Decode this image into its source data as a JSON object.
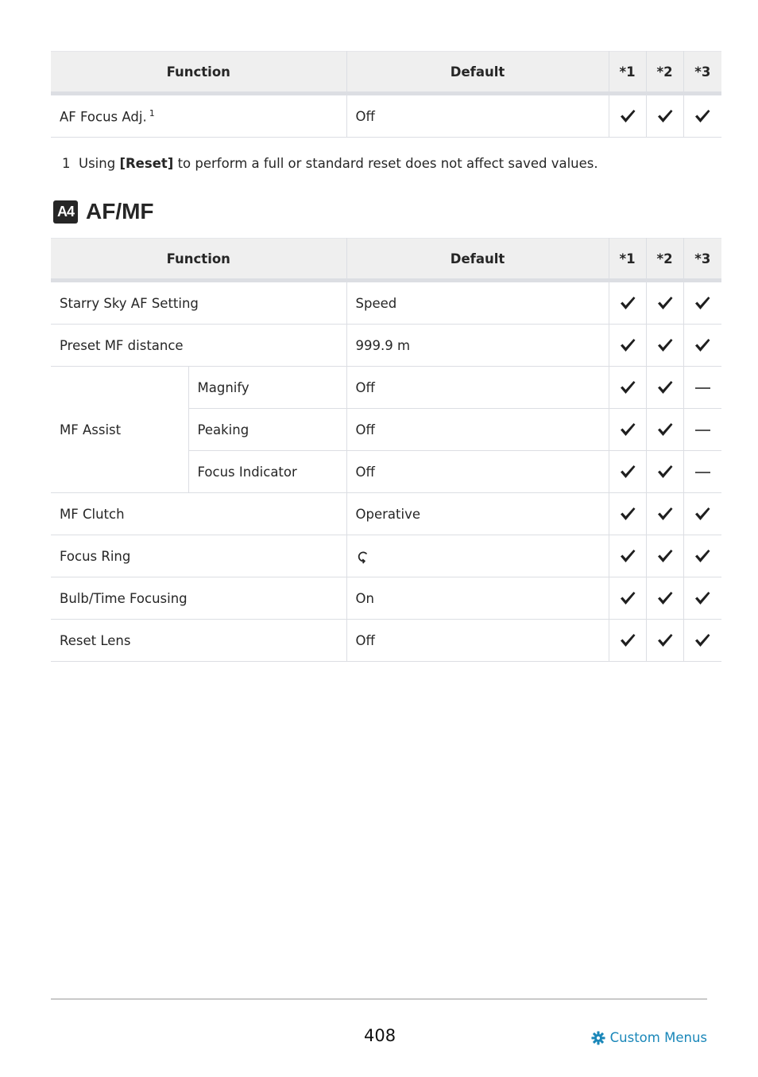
{
  "table1": {
    "headers": {
      "function": "Function",
      "default": "Default",
      "c1": "*1",
      "c2": "*2",
      "c3": "*3"
    },
    "rows": [
      {
        "function": "AF Focus Adj.",
        "footnote_ref": "1",
        "default": "Off",
        "marks": [
          "check",
          "check",
          "check"
        ]
      }
    ]
  },
  "footnote": {
    "number": "1",
    "text_before": "Using ",
    "bold": "[Reset]",
    "text_after": " to perform a full or standard reset does not affect saved values."
  },
  "section": {
    "badge": "A4",
    "title": "AF/MF"
  },
  "table2": {
    "headers": {
      "function": "Function",
      "default": "Default",
      "c1": "*1",
      "c2": "*2",
      "c3": "*3"
    },
    "rows": [
      {
        "function": "Starry Sky AF Setting",
        "default": "Speed",
        "marks": [
          "check",
          "check",
          "check"
        ]
      },
      {
        "function": "Preset MF distance",
        "default": "999.9 m",
        "marks": [
          "check",
          "check",
          "check"
        ]
      },
      {
        "group": "MF Assist",
        "sub": "Magnify",
        "default": "Off",
        "marks": [
          "check",
          "check",
          "dash"
        ]
      },
      {
        "group": "MF Assist",
        "sub": "Peaking",
        "default": "Off",
        "marks": [
          "check",
          "check",
          "dash"
        ]
      },
      {
        "group": "MF Assist",
        "sub": "Focus Indicator",
        "default": "Off",
        "marks": [
          "check",
          "check",
          "dash"
        ]
      },
      {
        "function": "MF Clutch",
        "default": "Operative",
        "marks": [
          "check",
          "check",
          "check"
        ]
      },
      {
        "function": "Focus Ring",
        "default_icon": "clockwise-rotation-icon",
        "marks": [
          "check",
          "check",
          "check"
        ]
      },
      {
        "function": "Bulb/Time Focusing",
        "default": "On",
        "marks": [
          "check",
          "check",
          "check"
        ]
      },
      {
        "function": "Reset Lens",
        "default": "Off",
        "marks": [
          "check",
          "check",
          "check"
        ]
      }
    ]
  },
  "footer": {
    "page_number": "408",
    "link_label": "Custom Menus",
    "link_icon": "gear-icon",
    "link_color": "#1a87b9"
  }
}
